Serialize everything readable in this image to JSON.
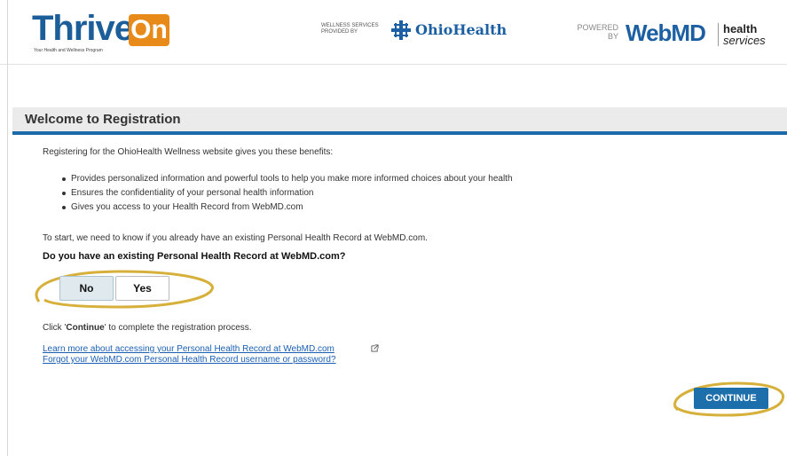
{
  "header": {
    "thrive_word": "Thrive",
    "thrive_on": "On",
    "thrive_tagline": "Your Health and Wellness Program",
    "ohio_small": "WELLNESS SERVICES PROVIDED BY",
    "ohio_name": "OhioHealth",
    "powered_by": "POWERED BY",
    "webmd": "WebMD",
    "health": "health",
    "services": "services"
  },
  "page": {
    "title": "Welcome to Registration",
    "intro": "Registering for the OhioHealth Wellness website gives you these benefits:",
    "benefits": [
      "Provides personalized information and powerful tools to help you make more informed choices about your health",
      "Ensures the confidentiality of your personal health information",
      "Gives you access to your Health Record from WebMD.com"
    ],
    "start_text": "To start, we need to know if you already have an existing Personal Health Record at WebMD.com.",
    "question": "Do you have an existing Personal Health Record at WebMD.com?",
    "no_label": "No",
    "yes_label": "Yes",
    "selected": "No",
    "click_prefix": "Click '",
    "click_bold": "Continue",
    "click_suffix": "' to complete the registration process.",
    "link_learn": "Learn more about accessing your Personal Health Record at WebMD.com",
    "link_forgot": "Forgot your WebMD.com Personal Health Record username or password?",
    "continue_label": "CONTINUE"
  },
  "colors": {
    "accent_blue": "#1b6aa9",
    "highlight_ring": "#d6b03a",
    "thrive_orange": "#e88a1a"
  }
}
